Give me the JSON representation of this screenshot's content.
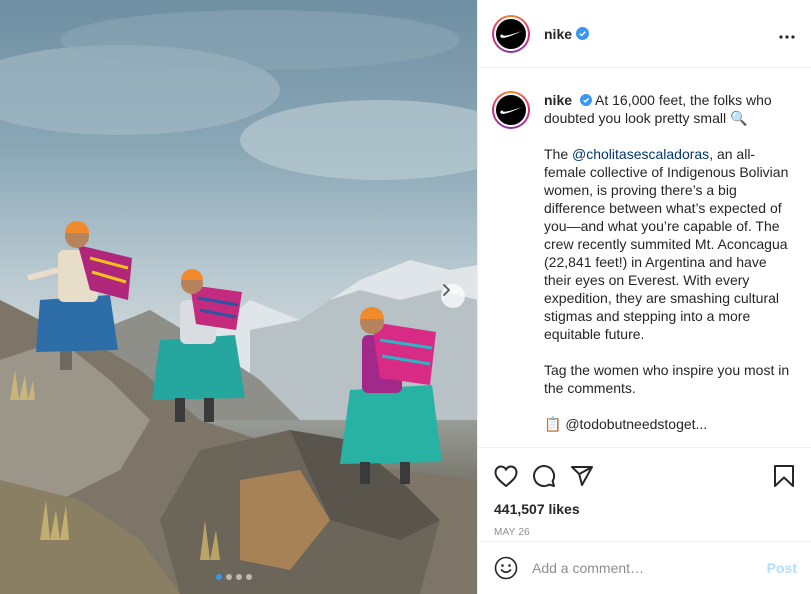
{
  "post": {
    "image_alt": "Women climbers in colorful skirts descending rocky mountain",
    "carousel": {
      "total": 4,
      "active_index": 0
    }
  },
  "header": {
    "username": "nike",
    "verified": true
  },
  "caption": {
    "username": "nike",
    "line1": "At 16,000 feet, the folks who doubted you look pretty small 🔍",
    "para2_pre": "The ",
    "para2_mention": "@cholitasescaladoras",
    "para2_post": ", an all-female collective of Indigenous Bolivian women, is proving there’s a big difference between what’s expected of you—and what you’re capable of. The crew recently summited Mt. Aconcagua (22,841 feet!) in Argentina and have their eyes on Everest. With every expedition, they are smashing cultural stigmas and stepping into a more equitable future.",
    "para3": "Tag the women who inspire you most in the comments.",
    "para4_cut": "📋 @todobutneedstoget..."
  },
  "engagement": {
    "likes": "441,507 likes",
    "date": "MAY 26"
  },
  "comment": {
    "placeholder": "Add a comment…",
    "post_label": "Post"
  },
  "colors": {
    "verified_blue": "#3897f0",
    "post_disabled": "#b2dffc",
    "mention": "#00376b"
  }
}
